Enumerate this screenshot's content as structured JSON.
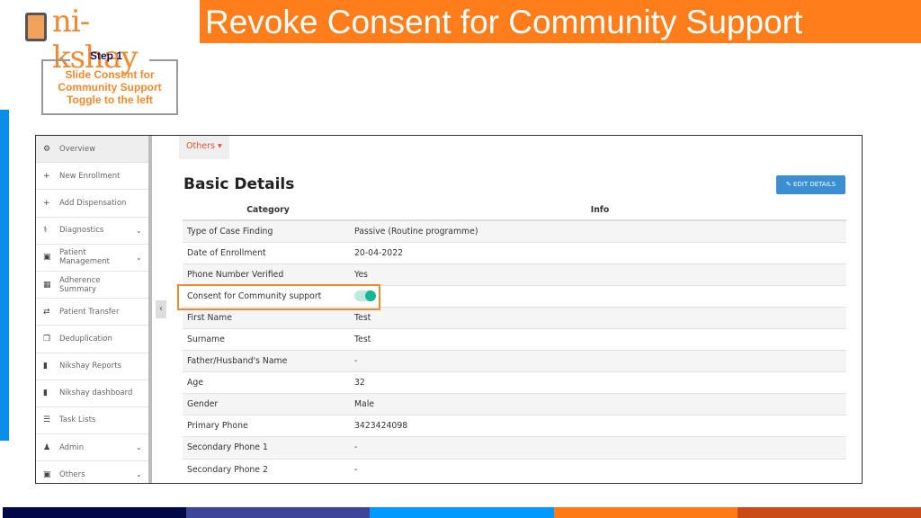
{
  "title": "Revoke Consent for Community Support",
  "logo": "ni-kshay",
  "step": {
    "label": "Step 1",
    "text": "Slide Consent for Community Support Toggle to the left"
  },
  "sidebar": {
    "items": [
      {
        "label": "Overview",
        "icon": "⚙",
        "chev": ""
      },
      {
        "label": "New Enrollment",
        "icon": "+",
        "chev": ""
      },
      {
        "label": "Add Dispensation",
        "icon": "+",
        "chev": ""
      },
      {
        "label": "Diagnostics",
        "icon": "⚕",
        "chev": "⌄"
      },
      {
        "label": "Patient Management",
        "icon": "▣",
        "chev": "⌄"
      },
      {
        "label": "Adherence Summary",
        "icon": "▦",
        "chev": ""
      },
      {
        "label": "Patient Transfer",
        "icon": "⇄",
        "chev": ""
      },
      {
        "label": "Deduplication",
        "icon": "❐",
        "chev": ""
      },
      {
        "label": "Nikshay Reports",
        "icon": "▮",
        "chev": ""
      },
      {
        "label": "Nikshay dashboard",
        "icon": "▮",
        "chev": ""
      },
      {
        "label": "Task Lists",
        "icon": "☰",
        "chev": ""
      },
      {
        "label": "Admin",
        "icon": "♟",
        "chev": "⌄"
      },
      {
        "label": "Others",
        "icon": "▣",
        "chev": "⌄"
      }
    ]
  },
  "collapse_icon": "‹",
  "tab": "Others ▾",
  "panel": {
    "title": "Basic Details",
    "edit": "✎ EDIT DETAILS"
  },
  "table": {
    "headers": [
      "Category",
      "Info"
    ],
    "rows": [
      [
        "Type of Case Finding",
        "Passive (Routine programme)"
      ],
      [
        "Date of Enrollment",
        "20-04-2022"
      ],
      [
        "Phone Number Verified",
        "Yes"
      ],
      [
        "Consent for Community support",
        ""
      ],
      [
        "First Name",
        "Test"
      ],
      [
        "Surname",
        "Test"
      ],
      [
        "Father/Husband's Name",
        "-"
      ],
      [
        "Age",
        "32"
      ],
      [
        "Gender",
        "Male"
      ],
      [
        "Primary Phone",
        "3423424098"
      ],
      [
        "Secondary Phone 1",
        "-"
      ],
      [
        "Secondary Phone 2",
        "-"
      ]
    ]
  },
  "consent_toggle_on": true,
  "colors": {
    "accent": "#ff7d1a",
    "bottom": [
      "#000845",
      "#3f4596",
      "#0099ff",
      "#ff7a14",
      "#c84b18"
    ]
  }
}
